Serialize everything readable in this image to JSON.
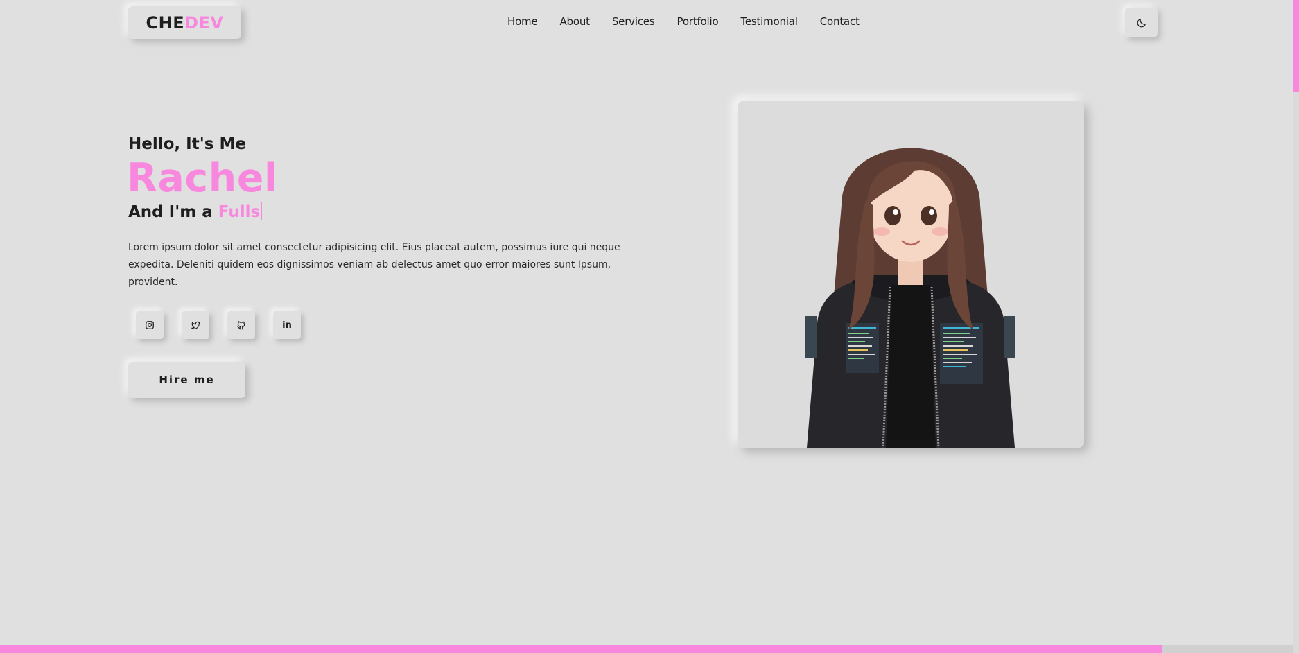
{
  "header": {
    "logo_part1": "CHE",
    "logo_part2": "DEV",
    "nav": [
      "Home",
      "About",
      "Services",
      "Portfolio",
      "Testimonial",
      "Contact"
    ],
    "theme_icon": "moon-icon"
  },
  "hero": {
    "greeting": "Hello, It's Me",
    "name": "Rachel",
    "role_prefix": "And I'm a ",
    "role_typed": "Fulls",
    "description": "Lorem ipsum dolor sit amet consectetur adipisicing elit. Eius placeat autem, possimus iure qui neque expedita. Deleniti quidem eos dignissimos veniam ab delectus amet quo error maiores sunt Ipsum, provident.",
    "socials": [
      {
        "icon": "instagram-icon"
      },
      {
        "icon": "twitter-icon"
      },
      {
        "icon": "github-icon"
      },
      {
        "icon": "linkedin-icon",
        "label": "in"
      }
    ],
    "hire_label": "Hire me"
  },
  "colors": {
    "accent": "#f788dd",
    "background": "#e0e0e0",
    "text": "#1e1e1e"
  }
}
